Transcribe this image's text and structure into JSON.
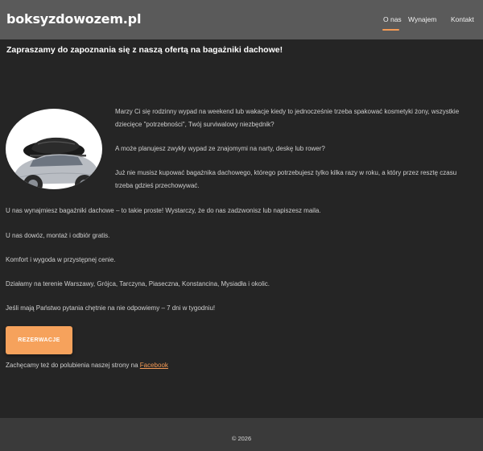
{
  "header": {
    "brand": "boksyzdowozem.pl",
    "nav": [
      {
        "label": "O nas",
        "active": true
      },
      {
        "label": "Wynajem",
        "active": false
      },
      {
        "label": "Kontakt",
        "active": false
      }
    ]
  },
  "main": {
    "title": "Zapraszamy do zapoznania się z naszą ofertą na bagażniki dachowe!",
    "intro": [
      "Marzy Ci się rodzinny wypad na weekend lub wakacje kiedy to jednocześnie trzeba spakować kosmetyki żony, wszystkie",
      "dziecięce \"potrzebności\", Twój surviwalowy niezbędnik?",
      "A może planujesz zwykły wypad ze znajomymi na narty, deskę lub rower?",
      "Już nie musisz kupować bagażnika dachowego, którego potrzebujesz tylko kilka razy w roku, a który przez resztę czasu",
      "trzeba gdzieś przechowywać."
    ],
    "paragraphs": [
      "U nas wynajmiesz bagażniki dachowe – to takie proste! Wystarczy, że do nas zadzwonisz lub napiszesz maila.",
      "U nas dowóz, montaż i odbiór gratis.",
      "Komfort i wygoda w przystępnej cenie.",
      "Działamy na terenie Warszawy, Grójca, Tarczyna, Piaseczna, Konstancina, Mysiadła i okolic.",
      "Jeśli mają Państwo pytania chętnie na nie odpowiemy – 7 dni w tygodniu!"
    ],
    "button_label": "REZERWACJE",
    "facebook_text": "Zachęcamy też do polubienia naszej strony na ",
    "facebook_link": "Facebook"
  },
  "footer": {
    "copyright": "© 2026"
  },
  "colors": {
    "accent": "#f6a25c",
    "header_bg": "#5a5a5a",
    "page_bg": "#252525",
    "footer_bg": "#3a3a3a"
  }
}
